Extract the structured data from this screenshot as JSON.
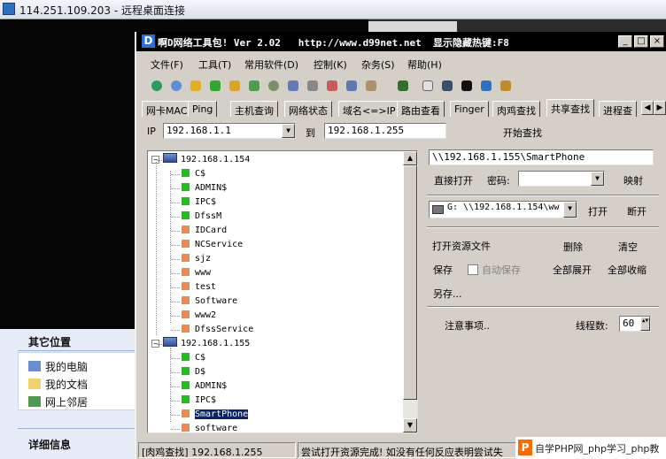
{
  "rdp": {
    "title": "114.251.109.203 - 远程桌面连接"
  },
  "explorer": {
    "other_places_title": "其它位置",
    "links": [
      "我的电脑",
      "我的文档",
      "网上邻居"
    ],
    "details_title": "详细信息"
  },
  "app": {
    "title": "啊D网络工具包! Ver 2.02   http://www.d99net.net  显示隐藏热键:F8",
    "title_buttons": [
      "_",
      "□",
      "×"
    ],
    "menu": [
      "文件(F)",
      "工具(T)",
      "常用软件(D)",
      "控制(K)",
      "杂务(S)",
      "帮助(H)"
    ],
    "tabs": [
      "网卡MAC",
      "Ping",
      "主机查询",
      "网络状态",
      "域名<=>IP",
      "路由查看",
      "Finger",
      "肉鸡查找",
      "共享查找",
      "进程查"
    ],
    "active_tab": "共享查找"
  },
  "scan": {
    "ip_label": "IP",
    "ip_from": "192.168.1.1",
    "to_label": "到",
    "ip_to": "192.168.1.255",
    "start_button": "开始查找"
  },
  "tree": {
    "hosts": [
      {
        "name": "192.168.1.154",
        "shares": [
          {
            "name": "C$",
            "color": "green"
          },
          {
            "name": "ADMIN$",
            "color": "green"
          },
          {
            "name": "IPC$",
            "color": "green"
          },
          {
            "name": "DfssM",
            "color": "green"
          },
          {
            "name": "IDCard",
            "color": "orange"
          },
          {
            "name": "NCService",
            "color": "orange"
          },
          {
            "name": "sjz",
            "color": "orange"
          },
          {
            "name": "www",
            "color": "orange"
          },
          {
            "name": "test",
            "color": "orange"
          },
          {
            "name": "Software",
            "color": "orange"
          },
          {
            "name": "www2",
            "color": "orange"
          },
          {
            "name": "DfssService",
            "color": "orange"
          }
        ]
      },
      {
        "name": "192.168.1.155",
        "shares": [
          {
            "name": "C$",
            "color": "green"
          },
          {
            "name": "D$",
            "color": "green"
          },
          {
            "name": "ADMIN$",
            "color": "green"
          },
          {
            "name": "IPC$",
            "color": "green"
          },
          {
            "name": "SmartPhone",
            "color": "orange",
            "selected": true
          },
          {
            "name": "software",
            "color": "orange"
          }
        ]
      }
    ]
  },
  "right": {
    "path": "\\\\192.168.1.155\\SmartPhone",
    "direct_open": "直接打开",
    "password_label": "密码:",
    "password_value": "",
    "map_button": "映射",
    "drive_combo": "G: \\\\192.168.1.154\\ww",
    "open_button": "打开",
    "disconnect_button": "断开",
    "open_res_file": "打开资源文件",
    "delete": "删除",
    "clear": "清空",
    "save": "保存",
    "auto_save": "自动保存",
    "expand_all": "全部展开",
    "collapse_all": "全部收缩",
    "save_as": "另存...",
    "notes": "注意事项..",
    "threads_label": "线程数:",
    "threads_value": "60"
  },
  "status": {
    "left": "[肉鸡查找] 192.168.1.255",
    "right": "尝试打开资源完成! 如没有任何反应表明尝试失"
  },
  "watermark": {
    "text": "自学PHP网_php学习_php教"
  },
  "colors": {
    "green": "#19c219",
    "orange": "#f08a4a",
    "titlebar": "#000000"
  }
}
